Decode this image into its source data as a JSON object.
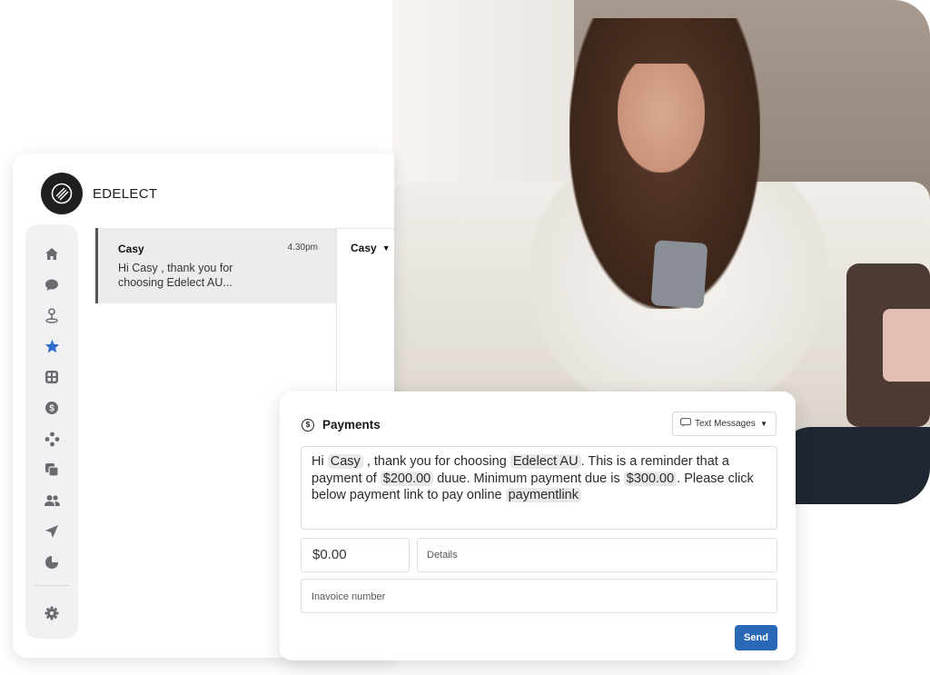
{
  "brand": {
    "name": "EDELECT"
  },
  "sidebar": {
    "icons": [
      {
        "name": "home-icon"
      },
      {
        "name": "chat-icon"
      },
      {
        "name": "location-icon"
      },
      {
        "name": "star-icon",
        "active": true,
        "color": "#2a6fc9"
      },
      {
        "name": "apps-icon"
      },
      {
        "name": "dollar-icon"
      },
      {
        "name": "integrations-icon"
      },
      {
        "name": "copy-icon"
      },
      {
        "name": "contacts-icon"
      },
      {
        "name": "send-icon"
      },
      {
        "name": "reports-icon"
      },
      {
        "name": "settings-icon"
      }
    ]
  },
  "conversation": {
    "name": "Casy",
    "time": "4.30pm",
    "preview": "Hi  Casy , thank you for choosing   Edelect AU..."
  },
  "thread": {
    "contact": "Casy"
  },
  "payments": {
    "title": "Payments",
    "channel": "Text Messages",
    "message": {
      "greeting": "Hi",
      "name_tag": "Casy",
      "part1": ", thank you for choosing",
      "company_tag": "Edelect AU",
      "part2": ". This is a reminder that a payment of",
      "amount_tag": "$200.00",
      "part3": "duue. Minimum payment due is",
      "minimum_tag": "$300.00",
      "part4": ". Please click below payment link to pay online",
      "link_tag": "paymentlink"
    },
    "amount_value": "$0.00",
    "details_placeholder": "Details",
    "invoice_placeholder": "Inavoice number",
    "send_label": "Send"
  },
  "colors": {
    "accent": "#2868b6",
    "star": "#2a6fc9"
  }
}
